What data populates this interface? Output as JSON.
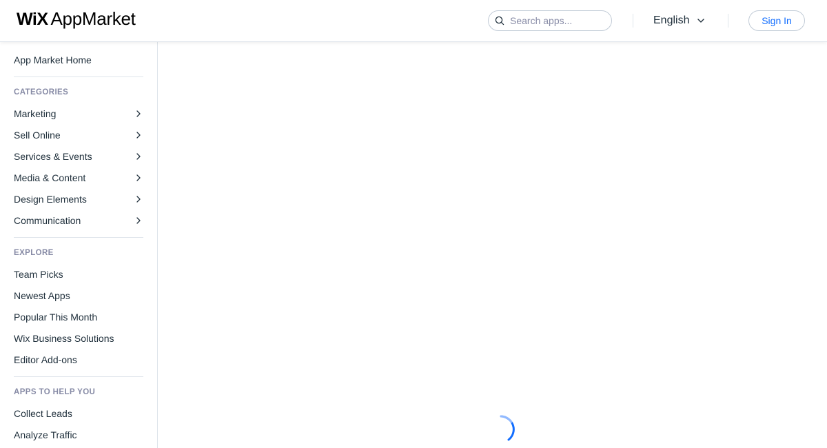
{
  "header": {
    "logo_wix": "WiX",
    "logo_app": "AppMarket",
    "search_placeholder": "Search apps...",
    "language": "English",
    "sign_in": "Sign In"
  },
  "sidebar": {
    "home": "App Market Home",
    "categories_heading": "CATEGORIES",
    "categories": [
      {
        "label": "Marketing"
      },
      {
        "label": "Sell Online"
      },
      {
        "label": "Services & Events"
      },
      {
        "label": "Media & Content"
      },
      {
        "label": "Design Elements"
      },
      {
        "label": "Communication"
      }
    ],
    "explore_heading": "EXPLORE",
    "explore": [
      {
        "label": "Team Picks"
      },
      {
        "label": "Newest Apps"
      },
      {
        "label": "Popular This Month"
      },
      {
        "label": "Wix Business Solutions"
      },
      {
        "label": "Editor Add-ons"
      }
    ],
    "help_heading": "APPS TO HELP YOU",
    "help": [
      {
        "label": "Collect Leads"
      },
      {
        "label": "Analyze Traffic"
      }
    ]
  },
  "colors": {
    "accent": "#116dff",
    "text": "#20303c",
    "muted": "#868aa5",
    "border": "#dfe5eb"
  },
  "icons": {
    "search": "search-icon",
    "language_toggle": "chevron-down-icon",
    "category_arrow": "chevron-right-icon",
    "loader": "loading-spinner-icon"
  }
}
